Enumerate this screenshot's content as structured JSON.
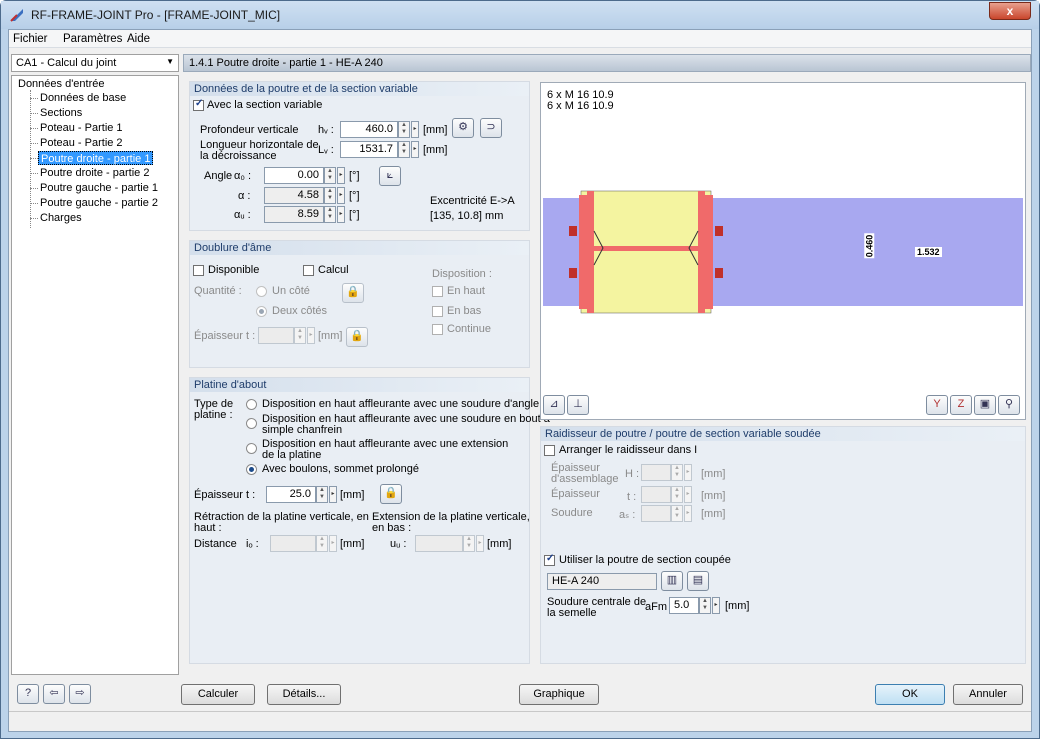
{
  "window": {
    "title": "RF-FRAME-JOINT Pro - [FRAME-JOINT_MIC]",
    "close": "x"
  },
  "menu": [
    "Fichier",
    "Paramètres",
    "Aide"
  ],
  "case_select": "CA1 - Calcul du joint",
  "tree": {
    "root": "Données d'entrée",
    "items": [
      "Données de base",
      "Sections",
      "Poteau - Partie 1",
      "Poteau - Partie 2",
      "Poutre droite - partie 1",
      "Poutre droite - partie 2",
      "Poutre gauche - partie 1",
      "Poutre gauche - partie 2",
      "Charges"
    ],
    "selected_index": 4
  },
  "panel_title": "1.4.1 Poutre droite - partie 1 - HE-A 240",
  "variable_section": {
    "title": "Données de la poutre et de la section variable",
    "checkbox": "Avec la section variable",
    "prof_label": "Profondeur verticale",
    "hv_sym": "hᵥ :",
    "hv": "460.0",
    "unit_mm": "[mm]",
    "long_label_1": "Longueur horizontale de",
    "long_label_2": "la décroissance",
    "lv_sym": "Lᵥ :",
    "lv": "1531.7",
    "angle_label": "Angle",
    "a0_sym": "α₀ :",
    "a0": "0.00",
    "a_sym": "α :",
    "a": "4.58",
    "au_sym": "αᵤ :",
    "au": "8.59",
    "unit_deg": "[°]",
    "exc_1": "Excentricité E->A",
    "exc_2": "[135, 10.8] mm"
  },
  "web_doubler": {
    "title": "Doublure d'âme",
    "available": "Disponible",
    "calc": "Calcul",
    "disposition": "Disposition :",
    "quantity": "Quantité :",
    "one_side": "Un côté",
    "two_sides": "Deux côtés",
    "top": "En haut",
    "bottom": "En bas",
    "continuous": "Continue",
    "thickness": "Épaisseur t :",
    "unit_mm": "[mm]"
  },
  "end_plate": {
    "title": "Platine d'about",
    "type_1": "Type de",
    "type_2": "platine :",
    "opt1": "Disposition en haut affleurante avec une soudure d'angle",
    "opt2_1": "Disposition en haut affleurante avec une soudure en bout à",
    "opt2_2": "simple chanfrein",
    "opt3_1": "Disposition en haut affleurante avec une extension",
    "opt3_2": "de la platine",
    "opt4": "Avec boulons, sommet prolongé",
    "thick_label": "Épaisseur",
    "t_sym": "t :",
    "t": "25.0",
    "unit_mm": "[mm]",
    "retr_1": "Rétraction de la platine verticale, en",
    "retr_2": "haut :",
    "ext_1": "Extension de la platine verticale,",
    "ext_2": "en bas :",
    "distance": "Distance",
    "io_sym": "iₒ :",
    "uu_sym": "uᵤ :"
  },
  "graphic": {
    "bolts_1": "6 x M 16 10.9",
    "bolts_2": "6 x M 16 10.9",
    "dim_v": "0.460",
    "dim_h": "1.532"
  },
  "stiffener": {
    "title": "Raidisseur de poutre / poutre de section variable soudée",
    "arrange": "Arranger le raidisseur dans I",
    "thick_asm_1": "Épaisseur",
    "thick_asm_2": "d'assemblage",
    "H_sym": "H :",
    "thick": "Épaisseur",
    "t_sym": "t :",
    "weld": "Soudure",
    "as_sym": "aₛ :",
    "unit_mm": "[mm]",
    "use_cut": "Utiliser la poutre de section coupée",
    "section": "HE-A 240",
    "central_1": "Soudure centrale de",
    "central_2": "la semelle",
    "aFm_sym": "aFm",
    "aFm": "5.0"
  },
  "buttons": {
    "calc": "Calculer",
    "details": "Détails...",
    "graphic": "Graphique",
    "ok": "OK",
    "cancel": "Annuler"
  },
  "colors": {
    "beam": "#a8a8f0",
    "plate": "#f06a6a",
    "column": "#f4f4a0"
  }
}
